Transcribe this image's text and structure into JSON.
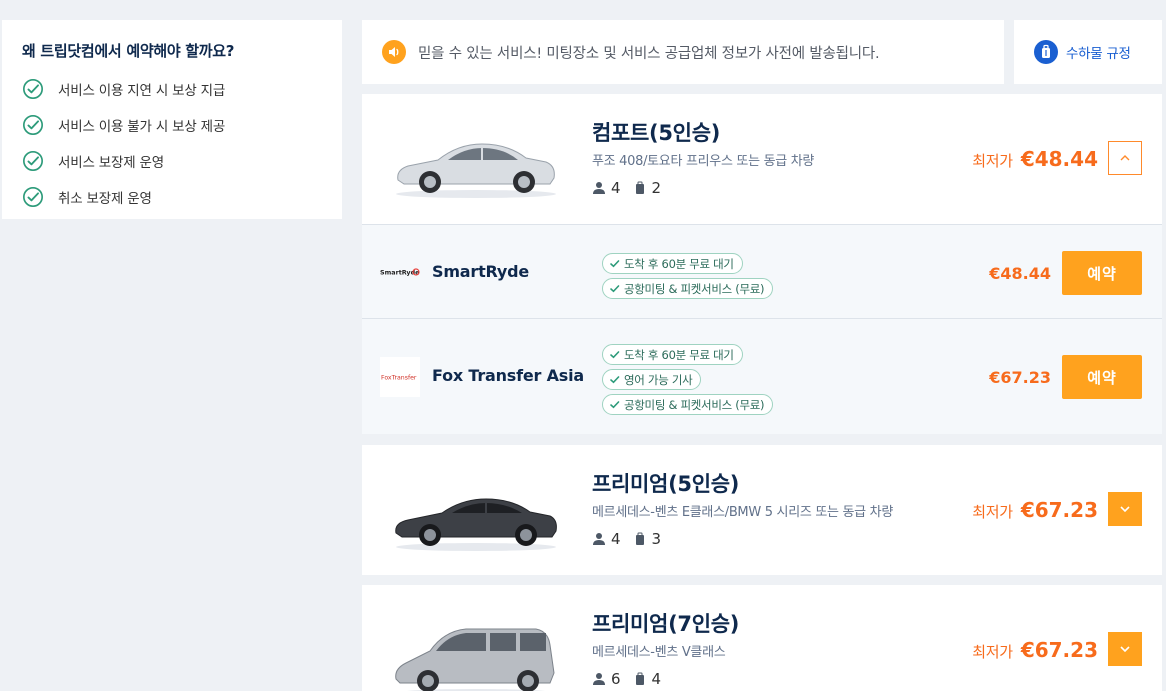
{
  "why": {
    "title": "왜 트립닷컴에서 예약해야 할까요?",
    "items": [
      "서비스 이용 지연 시 보상 지급",
      "서비스 이용 불가 시 보상 제공",
      "서비스 보장제 운영",
      "취소 보장제 운영"
    ]
  },
  "notice": {
    "text": "믿을 수 있는 서비스! 미팅장소 및 서비스 공급업체 정보가 사전에 발송됩니다."
  },
  "luggage": {
    "label": "수하물 규정"
  },
  "vehicles": [
    {
      "name": "컴포트(5인승)",
      "desc": "푸조 408/토요타 프리우스 또는 동급 차량",
      "passengers": "4",
      "bags": "2",
      "lowest_label": "최저가",
      "price": "€48.44"
    },
    {
      "name": "프리미엄(5인승)",
      "desc": "메르세데스-벤츠 E클래스/BMW 5 시리즈 또는 동급 차량",
      "passengers": "4",
      "bags": "3",
      "lowest_label": "최저가",
      "price": "€67.23"
    },
    {
      "name": "프리미엄(7인승)",
      "desc": "메르세데스-벤츠 V클래스",
      "passengers": "6",
      "bags": "4",
      "lowest_label": "최저가",
      "price": "€67.23"
    }
  ],
  "vendors": [
    {
      "name": "SmartRyde",
      "logo_text": "SmartRyde",
      "tags": [
        "도착 후 60분 무료 대기",
        "공항미팅 & 피켓서비스 (무료)"
      ],
      "price": "€48.44",
      "book_label": "예약"
    },
    {
      "name": "Fox Transfer Asia",
      "logo_text": "FoxTransfer",
      "tags": [
        "도착 후 60분 무료 대기",
        "영어 가능 기사",
        "공항미팅 & 피켓서비스 (무료)"
      ],
      "price": "€67.23",
      "book_label": "예약"
    }
  ],
  "colors": {
    "accent": "#ffa21e",
    "price": "#f76b1c",
    "check": "#2d9b7a",
    "link": "#1a5fd1"
  }
}
